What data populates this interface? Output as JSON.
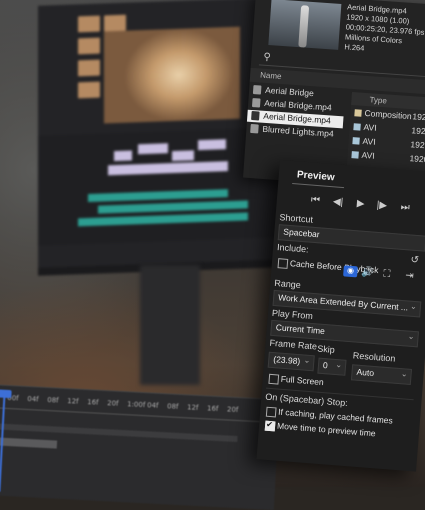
{
  "project_panel": {
    "clip_info": [
      "Aerial Bridge.mp4",
      "1920 x 1080 (1.00)",
      "00;00:25:20, 23.976 fps",
      "Millions of Colors",
      "H.264"
    ],
    "search_placeholder": "",
    "columns": {
      "name": "Name",
      "type": "Type",
      "extra": "V"
    },
    "items": [
      {
        "label": "Aerial Bridge",
        "type": "Composition",
        "res": "192",
        "color": "#d9c89a",
        "selected": false
      },
      {
        "label": "Aerial Bridge.mp4",
        "type": "AVI",
        "res": "192",
        "color": "#a8c6d8",
        "selected": false
      },
      {
        "label": "Aerial Bridge.mp4",
        "type": "AVI",
        "res": "1920",
        "color": "#a8c6d8",
        "selected": true
      },
      {
        "label": "Blurred Lights.mp4",
        "type": "AVI",
        "res": "1920",
        "color": "#a8c6d8",
        "selected": false
      }
    ]
  },
  "preview_panel": {
    "title": "Preview",
    "transport": [
      "⏮",
      "◀|",
      "▶",
      "|▶",
      "⏭"
    ],
    "shortcut_label": "Shortcut",
    "shortcut_value": "Spacebar",
    "include_label": "Include:",
    "cache_label": "Cache Before Playback",
    "range_label": "Range",
    "range_value": "Work Area Extended By Current ...",
    "play_from_label": "Play From",
    "play_from_value": "Current Time",
    "frame_rate_label": "Frame Rate",
    "frame_rate_value": "(23.98)",
    "skip_label": "Skip",
    "skip_value": "0",
    "resolution_label": "Resolution",
    "resolution_value": "Auto",
    "full_screen_label": "Full Screen",
    "on_stop_label": "On (Spacebar) Stop:",
    "if_caching_label": "If caching, play cached frames",
    "move_time_label": "Move time to preview time",
    "full_screen_checked": false,
    "if_caching_checked": false,
    "move_time_checked": true,
    "cache_checked": false
  },
  "timeline": {
    "ticks": [
      "00f",
      "04f",
      "08f",
      "12f",
      "16f",
      "20f",
      "1:00f",
      "04f",
      "08f",
      "12f",
      "16f",
      "20f",
      "2:00f",
      "04f"
    ]
  },
  "colors": {
    "accent_blue": "#2b66d6",
    "teal_clips": "#2fb5a5",
    "panel_bg": "#1e1e1e"
  }
}
